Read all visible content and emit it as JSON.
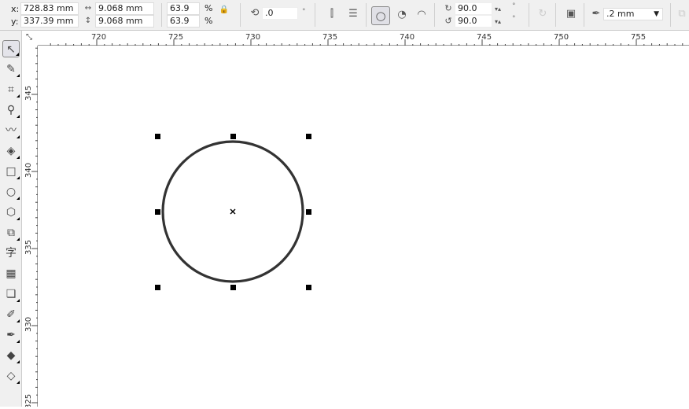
{
  "propbar": {
    "x_label": "x:",
    "x_value": "728.83 mm",
    "y_label": "y:",
    "y_value": "337.39 mm",
    "width_value": "9.068 mm",
    "height_value": "9.068 mm",
    "scale_x": "63.9",
    "scale_y": "63.9",
    "percent": "%",
    "rotation": ".0",
    "degree": "°",
    "start_angle": "90.0",
    "end_angle": "90.0",
    "outline_width": ".2 mm"
  },
  "ruler": {
    "h_labels": [
      "720",
      "725",
      "730",
      "735",
      "740",
      "745",
      "750",
      "755"
    ],
    "v_labels": [
      "345",
      "340",
      "335",
      "330",
      "325"
    ]
  },
  "toolbox": {
    "tools": [
      "pick-tool",
      "shape-tool",
      "crop-tool",
      "zoom-tool",
      "freehand-tool",
      "smart-fill-tool",
      "rectangle-tool",
      "ellipse-tool",
      "polygon-tool",
      "basic-shapes-tool",
      "text-tool",
      "table-tool",
      "drop-shadow-tool",
      "eyedropper-tool",
      "outline-tool",
      "fill-tool",
      "interactive-fill-tool"
    ]
  },
  "canvas": {
    "shape": "ellipse",
    "outline_color": "#333333",
    "selected": true
  }
}
